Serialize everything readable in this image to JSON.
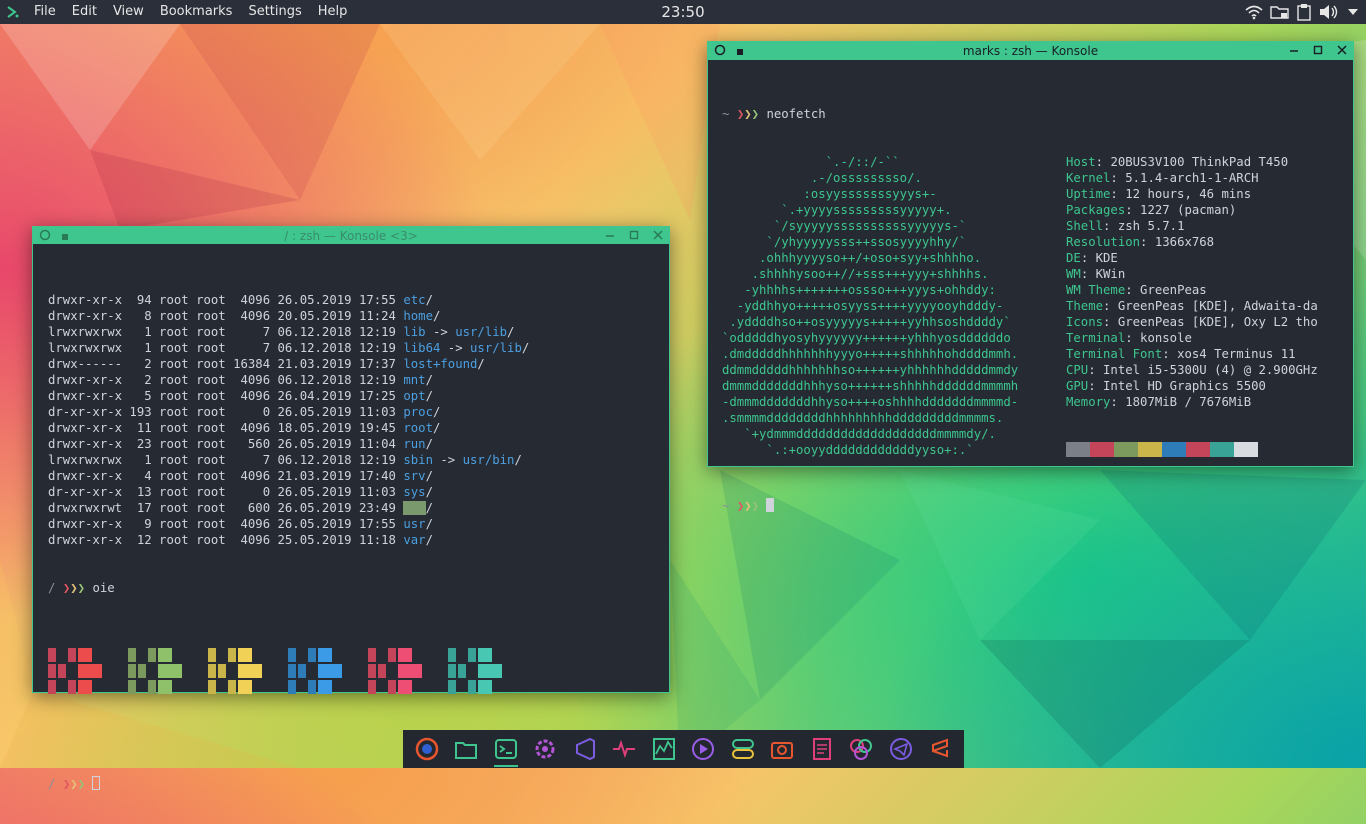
{
  "panel": {
    "menu": [
      "File",
      "Edit",
      "View",
      "Bookmarks",
      "Settings",
      "Help"
    ],
    "clock": "23:50",
    "tray_icons": [
      "wifi-icon",
      "folder-lock-icon",
      "clipboard-icon",
      "volume-icon",
      "chevron-down-icon"
    ]
  },
  "konsole_left": {
    "title": "/ : zsh — Konsole <3>",
    "listing": [
      {
        "perm": "drwxr-xr-x",
        "links": "94",
        "owner": "root",
        "group": "root",
        "size": "4096",
        "date": "26.05.2019",
        "time": "17:55",
        "name": "etc",
        "link": ""
      },
      {
        "perm": "drwxr-xr-x",
        "links": "8",
        "owner": "root",
        "group": "root",
        "size": "4096",
        "date": "20.05.2019",
        "time": "11:24",
        "name": "home",
        "link": ""
      },
      {
        "perm": "lrwxrwxrwx",
        "links": "1",
        "owner": "root",
        "group": "root",
        "size": "7",
        "date": "06.12.2018",
        "time": "12:19",
        "name": "lib",
        "link": "usr/lib"
      },
      {
        "perm": "lrwxrwxrwx",
        "links": "1",
        "owner": "root",
        "group": "root",
        "size": "7",
        "date": "06.12.2018",
        "time": "12:19",
        "name": "lib64",
        "link": "usr/lib"
      },
      {
        "perm": "drwx------",
        "links": "2",
        "owner": "root",
        "group": "root",
        "size": "16384",
        "date": "21.03.2019",
        "time": "17:37",
        "name": "lost+found",
        "link": ""
      },
      {
        "perm": "drwxr-xr-x",
        "links": "2",
        "owner": "root",
        "group": "root",
        "size": "4096",
        "date": "06.12.2018",
        "time": "12:19",
        "name": "mnt",
        "link": ""
      },
      {
        "perm": "drwxr-xr-x",
        "links": "5",
        "owner": "root",
        "group": "root",
        "size": "4096",
        "date": "26.04.2019",
        "time": "17:25",
        "name": "opt",
        "link": ""
      },
      {
        "perm": "dr-xr-xr-x",
        "links": "193",
        "owner": "root",
        "group": "root",
        "size": "0",
        "date": "26.05.2019",
        "time": "11:03",
        "name": "proc",
        "link": ""
      },
      {
        "perm": "drwxr-xr-x",
        "links": "11",
        "owner": "root",
        "group": "root",
        "size": "4096",
        "date": "18.05.2019",
        "time": "19:45",
        "name": "root",
        "link": ""
      },
      {
        "perm": "drwxr-xr-x",
        "links": "23",
        "owner": "root",
        "group": "root",
        "size": "560",
        "date": "26.05.2019",
        "time": "11:04",
        "name": "run",
        "link": ""
      },
      {
        "perm": "lrwxrwxrwx",
        "links": "1",
        "owner": "root",
        "group": "root",
        "size": "7",
        "date": "06.12.2018",
        "time": "12:19",
        "name": "sbin",
        "link": "usr/bin"
      },
      {
        "perm": "drwxr-xr-x",
        "links": "4",
        "owner": "root",
        "group": "root",
        "size": "4096",
        "date": "21.03.2019",
        "time": "17:40",
        "name": "srv",
        "link": ""
      },
      {
        "perm": "dr-xr-xr-x",
        "links": "13",
        "owner": "root",
        "group": "root",
        "size": "0",
        "date": "26.05.2019",
        "time": "11:03",
        "name": "sys",
        "link": ""
      },
      {
        "perm": "drwxrwxrwt",
        "links": "17",
        "owner": "root",
        "group": "root",
        "size": "600",
        "date": "26.05.2019",
        "time": "23:49",
        "name": "tmp",
        "link": "",
        "highlight": true
      },
      {
        "perm": "drwxr-xr-x",
        "links": "9",
        "owner": "root",
        "group": "root",
        "size": "4096",
        "date": "26.05.2019",
        "time": "17:55",
        "name": "usr",
        "link": ""
      },
      {
        "perm": "drwxr-xr-x",
        "links": "12",
        "owner": "root",
        "group": "root",
        "size": "4096",
        "date": "25.05.2019",
        "time": "11:18",
        "name": "var",
        "link": ""
      }
    ],
    "prompt_dir": "/",
    "prompt_arrows": "❯❯❯",
    "command": "oie",
    "block_colors": [
      "#c4455a",
      "#7c9a5e",
      "#c9b54a",
      "#2f7db8",
      "#c4455a",
      "#3aa398"
    ],
    "block_colors_bright": [
      "#ec4c4c",
      "#8fc06a",
      "#f1d156",
      "#3c9be6",
      "#ef4e74",
      "#48c8b2"
    ]
  },
  "konsole_right": {
    "title": "marks : zsh — Konsole",
    "prompt_dir": "~",
    "prompt_arrows": "❯❯❯",
    "command": "neofetch",
    "ascii": [
      "              `.-/::/-``",
      "            .-/osssssssso/.",
      "           :osyysssssssyyys+-",
      "        `.+yyyysssssssssyyyyy+.",
      "       `/syyyyyssssssssssyyyyys-`",
      "      `/yhyyyyysss++ssosyyyyhhy/`",
      "     .ohhhyyyyso++/+oso+syy+shhhho.",
      "    .shhhhysoo++//+sss+++yyy+shhhhs.",
      "   -yhhhhs+++++++ossso+++yyys+ohhddy:",
      "  -yddhhyo+++++osyyss++++yyyyooyhdddy-",
      " .yddddhso++osyyyyys+++++yyhhsoshddddy`",
      "`odddddhyosyhyyyyyy++++++yhhhyosddddddo",
      ".dmdddddhhhhhhhyyyo+++++shhhhhohddddmmh.",
      "ddmmdddddhhhhhhhso++++++yhhhhhhdddddmmdy",
      "dmmmdddddddhhhyso++++++shhhhhddddddmmmmh",
      "-dmmmdddddddhhyso++++oshhhhdddddddmmmmd-",
      ".smmmmddddddddhhhhhhhhhdddddddddmmmms.",
      "   `+ydmmmdddddddddddddddddddmmmmdy/.",
      "      `.:+ooyyddddddddddddyyso+:.`"
    ],
    "info": [
      {
        "key": "Host",
        "value": "20BUS3V100 ThinkPad T450"
      },
      {
        "key": "Kernel",
        "value": "5.1.4-arch1-1-ARCH"
      },
      {
        "key": "Uptime",
        "value": "12 hours, 46 mins"
      },
      {
        "key": "Packages",
        "value": "1227 (pacman)"
      },
      {
        "key": "Shell",
        "value": "zsh 5.7.1"
      },
      {
        "key": "Resolution",
        "value": "1366x768"
      },
      {
        "key": "DE",
        "value": "KDE"
      },
      {
        "key": "WM",
        "value": "KWin"
      },
      {
        "key": "WM Theme",
        "value": "GreenPeas"
      },
      {
        "key": "Theme",
        "value": "GreenPeas [KDE], Adwaita-da"
      },
      {
        "key": "Icons",
        "value": "GreenPeas [KDE], Oxy L2 tho"
      },
      {
        "key": "Terminal",
        "value": "konsole"
      },
      {
        "key": "Terminal Font",
        "value": "xos4 Terminus 11"
      },
      {
        "key": "CPU",
        "value": "Intel i5-5300U (4) @ 2.900GHz"
      },
      {
        "key": "GPU",
        "value": "Intel HD Graphics 5500"
      },
      {
        "key": "Memory",
        "value": "1807MiB / 7676MiB"
      }
    ],
    "palette": [
      "#7a7f88",
      "#c4455a",
      "#7c9a5e",
      "#c9b54a",
      "#2f7db8",
      "#c4455a",
      "#3aa398",
      "#d8dbe0"
    ]
  },
  "dock": {
    "items": [
      {
        "name": "firefox-icon",
        "color": "#e8562f"
      },
      {
        "name": "file-manager-icon",
        "color": "#3ec68e"
      },
      {
        "name": "konsole-icon",
        "color": "#3ec68e",
        "active": true
      },
      {
        "name": "system-settings-icon",
        "color": "#b455d8"
      },
      {
        "name": "vscode-icon",
        "color": "#7c5ce0"
      },
      {
        "name": "system-monitor-icon",
        "color": "#e0407a"
      },
      {
        "name": "ksysguard-icon",
        "color": "#3ec68e"
      },
      {
        "name": "media-player-icon",
        "color": "#9b5ce8"
      },
      {
        "name": "toggle-settings-icon",
        "color": "#3ec68e"
      },
      {
        "name": "screenshot-icon",
        "color": "#e8562f"
      },
      {
        "name": "text-editor-icon",
        "color": "#e0407a"
      },
      {
        "name": "color-picker-icon",
        "color": "#b455d8"
      },
      {
        "name": "telegram-icon",
        "color": "#7c5ce0"
      },
      {
        "name": "sublime-text-icon",
        "color": "#e8562f"
      }
    ]
  }
}
